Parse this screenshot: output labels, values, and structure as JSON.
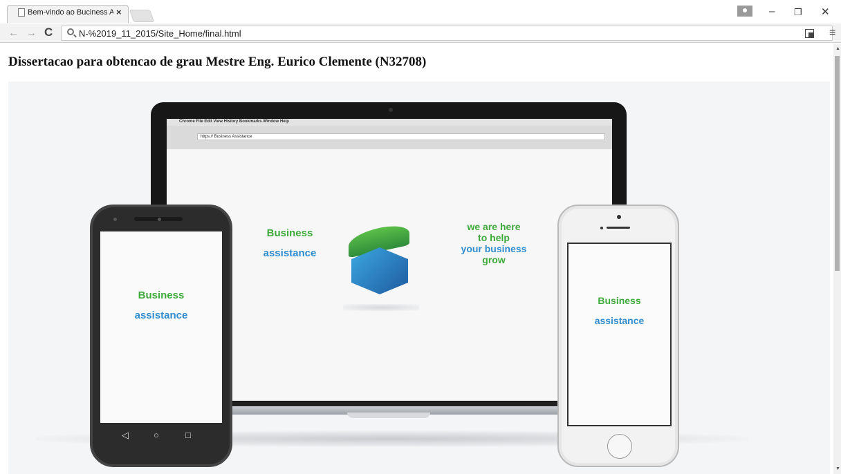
{
  "browser": {
    "tab_title": "Bem-vindo ao Buciness A",
    "tab_close": "×",
    "url": "N-%2019_11_2015/Site_Home/final.html",
    "back": "←",
    "forward": "→",
    "reload": "C",
    "menu": "≡",
    "minimize": "–",
    "restore": "❐",
    "close": "✕"
  },
  "page": {
    "title": "Dissertacao para obtencao de grau Mestre Eng. Eurico Clemente (N32708)"
  },
  "hero": {
    "inner_browser": {
      "menu": "Chrome  File  Edit  View  History  Bookmarks  Window  Help",
      "url": "https://  Business Assistance"
    },
    "center_line1": "Business",
    "center_line2": "assistance",
    "slogan_line1": "we are here",
    "slogan_line2": "to help",
    "slogan_line3": "your business",
    "slogan_line4": "grow",
    "android_line1": "Business",
    "android_line2": "assistance",
    "android_nav": [
      "◁",
      "○",
      "□"
    ],
    "iphone_line1": "Business",
    "iphone_line2": "assistance"
  },
  "colors": {
    "green": "#3daa3a",
    "blue": "#2f8dcf"
  }
}
